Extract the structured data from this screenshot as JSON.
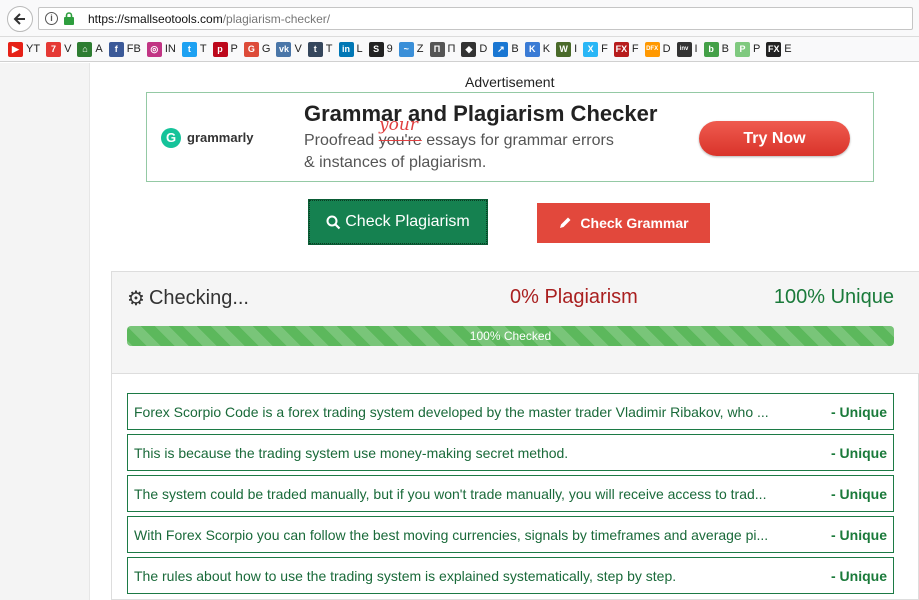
{
  "browser": {
    "url_host": "https://smallseotools.com",
    "url_path": "/plagiarism-checker/"
  },
  "bookmarks": [
    {
      "label": "YT",
      "icon": "youtube-icon",
      "color": "#e62117",
      "glyph": "▶"
    },
    {
      "label": "V",
      "icon": "v-icon",
      "color": "#e53935",
      "glyph": "7"
    },
    {
      "label": "A",
      "icon": "home-icon",
      "color": "#2e7d32",
      "glyph": "⌂"
    },
    {
      "label": "FB",
      "icon": "facebook-icon",
      "color": "#3b5998",
      "glyph": "f"
    },
    {
      "label": "IN",
      "icon": "instagram-icon",
      "color": "#c13584",
      "glyph": "◎"
    },
    {
      "label": "T",
      "icon": "twitter-icon",
      "color": "#1da1f2",
      "glyph": "t"
    },
    {
      "label": "P",
      "icon": "pinterest-icon",
      "color": "#bd081c",
      "glyph": "p"
    },
    {
      "label": "G",
      "icon": "google-plus-icon",
      "color": "#dd4b39",
      "glyph": "G"
    },
    {
      "label": "V",
      "icon": "vk-icon",
      "color": "#4a76a8",
      "glyph": "vk"
    },
    {
      "label": "T",
      "icon": "tumblr-icon",
      "color": "#35465c",
      "glyph": "t"
    },
    {
      "label": "L",
      "icon": "linkedin-icon",
      "color": "#0077b5",
      "glyph": "in"
    },
    {
      "label": "9",
      "icon": "s-icon",
      "color": "#222222",
      "glyph": "S"
    },
    {
      "label": "Z",
      "icon": "z-icon",
      "color": "#3a8fd8",
      "glyph": "~"
    },
    {
      "label": "П",
      "icon": "p-ru-icon",
      "color": "#555555",
      "glyph": "Π"
    },
    {
      "label": "D",
      "icon": "d-icon",
      "color": "#333333",
      "glyph": "◆"
    },
    {
      "label": "B",
      "icon": "chart-icon",
      "color": "#1976d2",
      "glyph": "↗"
    },
    {
      "label": "K",
      "icon": "k-icon",
      "color": "#3a7bd5",
      "glyph": "K"
    },
    {
      "label": "I",
      "icon": "i-icon",
      "color": "#4a6a2a",
      "glyph": "W"
    },
    {
      "label": "F",
      "icon": "x-icon",
      "color": "#29b6f6",
      "glyph": "X"
    },
    {
      "label": "F",
      "icon": "fxs-icon",
      "color": "#b71c1c",
      "glyph": "FX"
    },
    {
      "label": "D",
      "icon": "dfx-icon",
      "color": "#ff9800",
      "glyph": "DFX"
    },
    {
      "label": "I",
      "icon": "inv-icon",
      "color": "#333333",
      "glyph": "inv"
    },
    {
      "label": "B",
      "icon": "b-icon",
      "color": "#43a047",
      "glyph": "b"
    },
    {
      "label": "P",
      "icon": "p-icon",
      "color": "#7fc97f",
      "glyph": "P"
    },
    {
      "label": "E",
      "icon": "e-icon",
      "color": "#222222",
      "glyph": "FX"
    }
  ],
  "ad": {
    "label": "Advertisement",
    "brand": "grammarly",
    "title": "Grammar and Plagiarism Checker",
    "line1_pre": "Proofread ",
    "line1_struck": "you're",
    "line1_post": " essays for grammar errors",
    "correction": "your",
    "line2": "& instances of plagiarism.",
    "cta": "Try Now"
  },
  "actions": {
    "check_plagiarism": "Check Plagiarism",
    "check_grammar": "Check Grammar"
  },
  "results": {
    "status": "Checking...",
    "plagiarism": "0% Plagiarism",
    "unique": "100% Unique",
    "progress_label": "100% Checked",
    "progress_value": 100,
    "sentences": [
      {
        "text": "Forex Scorpio Code is a forex trading system developed by the master trader Vladimir Ribakov, who ...",
        "status": "- Unique"
      },
      {
        "text": "This is because the trading system use money-making secret method.",
        "status": "- Unique"
      },
      {
        "text": "The system could be traded manually, but if you won't trade manually, you will receive access to trad...",
        "status": "- Unique"
      },
      {
        "text": "With Forex Scorpio you can follow the best moving currencies, signals by timeframes and average pi...",
        "status": "- Unique"
      },
      {
        "text": "The rules about how to use the trading system is explained systematically, step by step.",
        "status": "- Unique"
      }
    ]
  },
  "colors": {
    "plagiarism_button": "#158150",
    "grammar_button": "#e2483c",
    "plagiarism_text": "#a91f1f",
    "unique_text": "#1a7a3a",
    "progress": "#5cb85c"
  }
}
